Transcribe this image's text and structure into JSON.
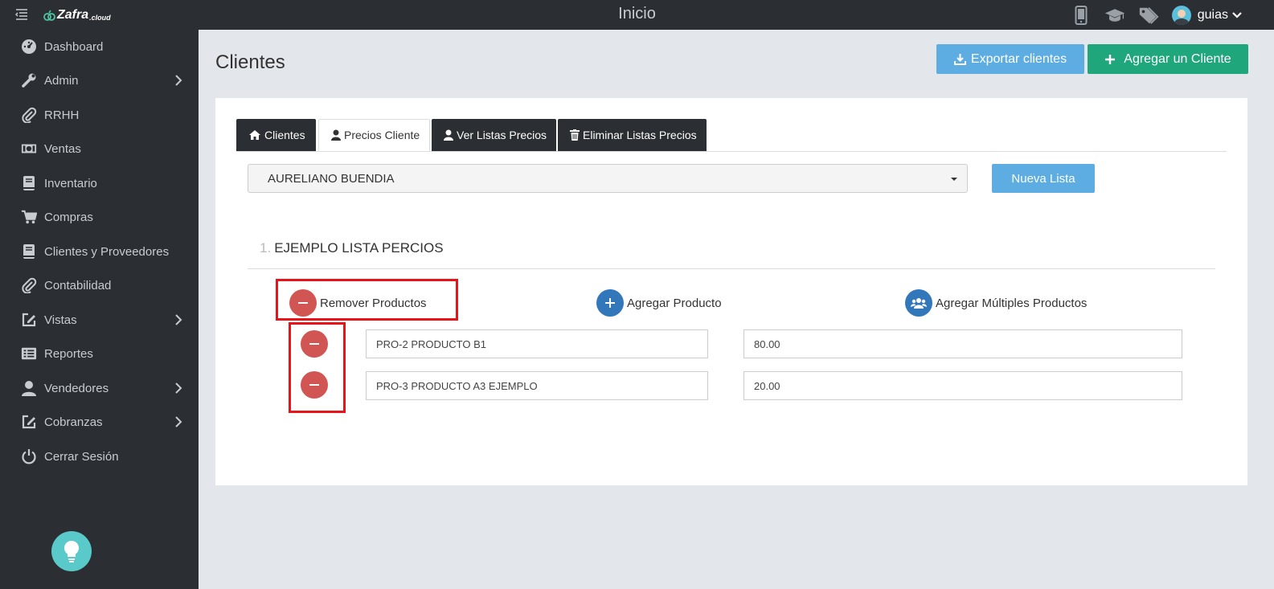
{
  "header": {
    "logo_text": "Zafra",
    "logo_suffix": ".cloud",
    "title": "Inicio",
    "user_name": "guias",
    "icons": [
      "menu-icon",
      "mobile-icon",
      "graduation-cap-icon",
      "tags-icon",
      "avatar",
      "chevron-down-icon"
    ]
  },
  "sidebar": {
    "items": [
      {
        "label": "Dashboard",
        "icon": "dashboard-icon",
        "submenu": false
      },
      {
        "label": "Admin",
        "icon": "wrench-icon",
        "submenu": true
      },
      {
        "label": "RRHH",
        "icon": "paperclip-icon",
        "submenu": false
      },
      {
        "label": "Ventas",
        "icon": "money-icon",
        "submenu": false
      },
      {
        "label": "Inventario",
        "icon": "book-icon",
        "submenu": false
      },
      {
        "label": "Compras",
        "icon": "cart-icon",
        "submenu": false
      },
      {
        "label": "Clientes y Proveedores",
        "icon": "book-icon",
        "submenu": false
      },
      {
        "label": "Contabilidad",
        "icon": "paperclip-icon",
        "submenu": false
      },
      {
        "label": "Vistas",
        "icon": "edit-icon",
        "submenu": true
      },
      {
        "label": "Reportes",
        "icon": "list-icon",
        "submenu": false
      },
      {
        "label": "Vendedores",
        "icon": "user-icon",
        "submenu": true
      },
      {
        "label": "Cobranzas",
        "icon": "edit-icon",
        "submenu": true
      },
      {
        "label": "Cerrar Sesión",
        "icon": "power-icon",
        "submenu": false
      }
    ],
    "help_icon": "lightbulb-icon"
  },
  "main": {
    "title": "Clientes",
    "export_label": "Exportar clientes",
    "add_label": "Agregar un Cliente",
    "tabs": [
      {
        "label": "Clientes",
        "icon": "home-icon",
        "active": false
      },
      {
        "label": "Precios Cliente",
        "icon": "user-icon",
        "active": true
      },
      {
        "label": "Ver Listas Precios",
        "icon": "user-icon",
        "active": false
      },
      {
        "label": "Eliminar Listas Precios",
        "icon": "trash-icon",
        "active": false
      }
    ],
    "client_select": "AURELIANO BUENDIA",
    "new_list_label": "Nueva Lista",
    "list": {
      "number": "1.",
      "name": "EJEMPLO LISTA PERCIOS",
      "remove_label": "Remover Productos",
      "add_label": "Agregar Producto",
      "add_multi_label": "Agregar Múltiples Productos",
      "rows": [
        {
          "product": "PRO-2 PRODUCTO B1",
          "price": "80.00"
        },
        {
          "product": "PRO-3 PRODUCTO A3 EJEMPLO",
          "price": "20.00"
        }
      ]
    }
  },
  "colors": {
    "dark": "#2b2e33",
    "accent_blue": "#5dade2",
    "accent_green": "#1fa67a",
    "remove_red": "#d05553",
    "add_blue": "#3377bb",
    "highlight": "#e8141a"
  }
}
